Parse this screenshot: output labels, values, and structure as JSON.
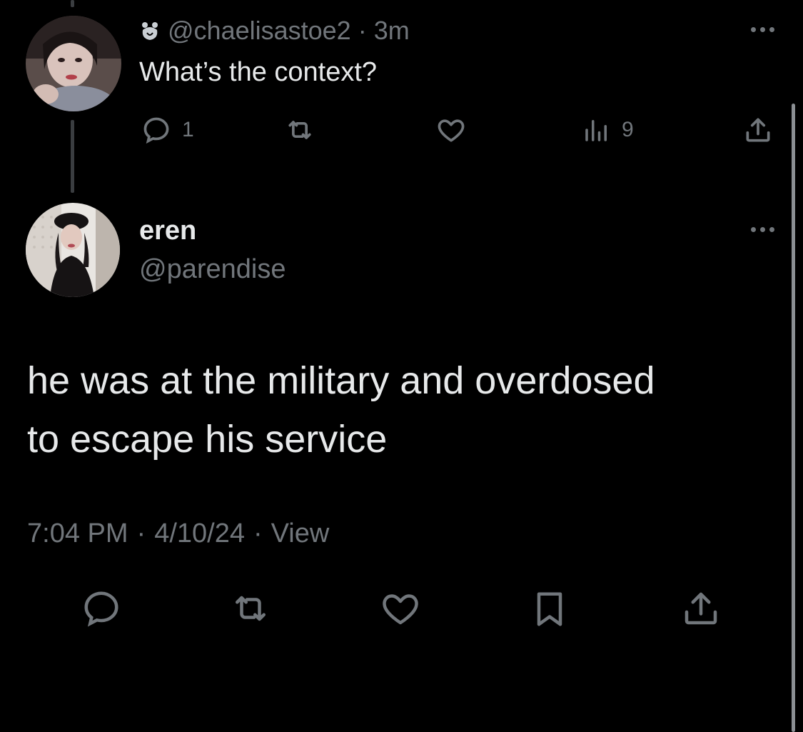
{
  "reply": {
    "badge_icon": "bear-icon",
    "handle": "@chaelisastoe2",
    "separator": "·",
    "time": "3m",
    "text": "What’s the context?",
    "actions": {
      "reply_count": "1",
      "retweet_count": "",
      "like_count": "",
      "views_count": "9"
    }
  },
  "main_tweet": {
    "name": "eren",
    "handle": "@parendise",
    "text_line1": "he was at the military and overdosed",
    "text_line2": "to escape his service",
    "time": "7:04 PM",
    "sep1": "·",
    "date": "4/10/24",
    "sep2": "·",
    "view_label": "View"
  },
  "icons": {
    "reply": "reply-icon",
    "retweet": "retweet-icon",
    "like": "heart-icon",
    "views": "views-icon",
    "share": "share-icon",
    "bookmark": "bookmark-icon",
    "more": "more-icon"
  },
  "colors": {
    "background": "#000000",
    "text": "#e7e9ea",
    "muted": "#71767b"
  }
}
